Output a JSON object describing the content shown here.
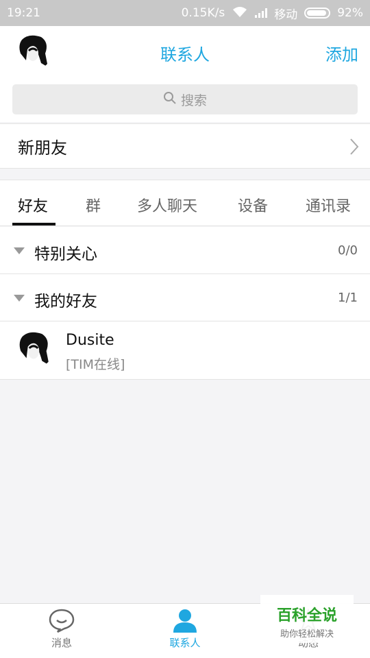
{
  "status_bar": {
    "time": "19:21",
    "speed": "0.15K/s",
    "carrier": "移动",
    "battery": "92%"
  },
  "header": {
    "title": "联系人",
    "add_label": "添加"
  },
  "search": {
    "placeholder": "搜索"
  },
  "new_friends": {
    "label": "新朋友"
  },
  "tabs": [
    {
      "label": "好友",
      "active": true
    },
    {
      "label": "群",
      "active": false
    },
    {
      "label": "多人聊天",
      "active": false
    },
    {
      "label": "设备",
      "active": false
    },
    {
      "label": "通讯录",
      "active": false
    }
  ],
  "groups": [
    {
      "name": "特别关心",
      "count": "0/0"
    },
    {
      "name": "我的好友",
      "count": "1/1"
    }
  ],
  "contacts": [
    {
      "name": "Dusite",
      "status": "[TIM在线]"
    }
  ],
  "bottom_nav": [
    {
      "label": "消息",
      "icon": "chat-bubble-icon"
    },
    {
      "label": "联系人",
      "icon": "person-icon"
    },
    {
      "label": "动态",
      "icon": "star-icon"
    }
  ],
  "watermark": {
    "title": "百科全说",
    "subtitle": "助你轻松解决"
  },
  "colors": {
    "accent": "#1fa7e0",
    "status_bar": "#c8c8c8"
  }
}
